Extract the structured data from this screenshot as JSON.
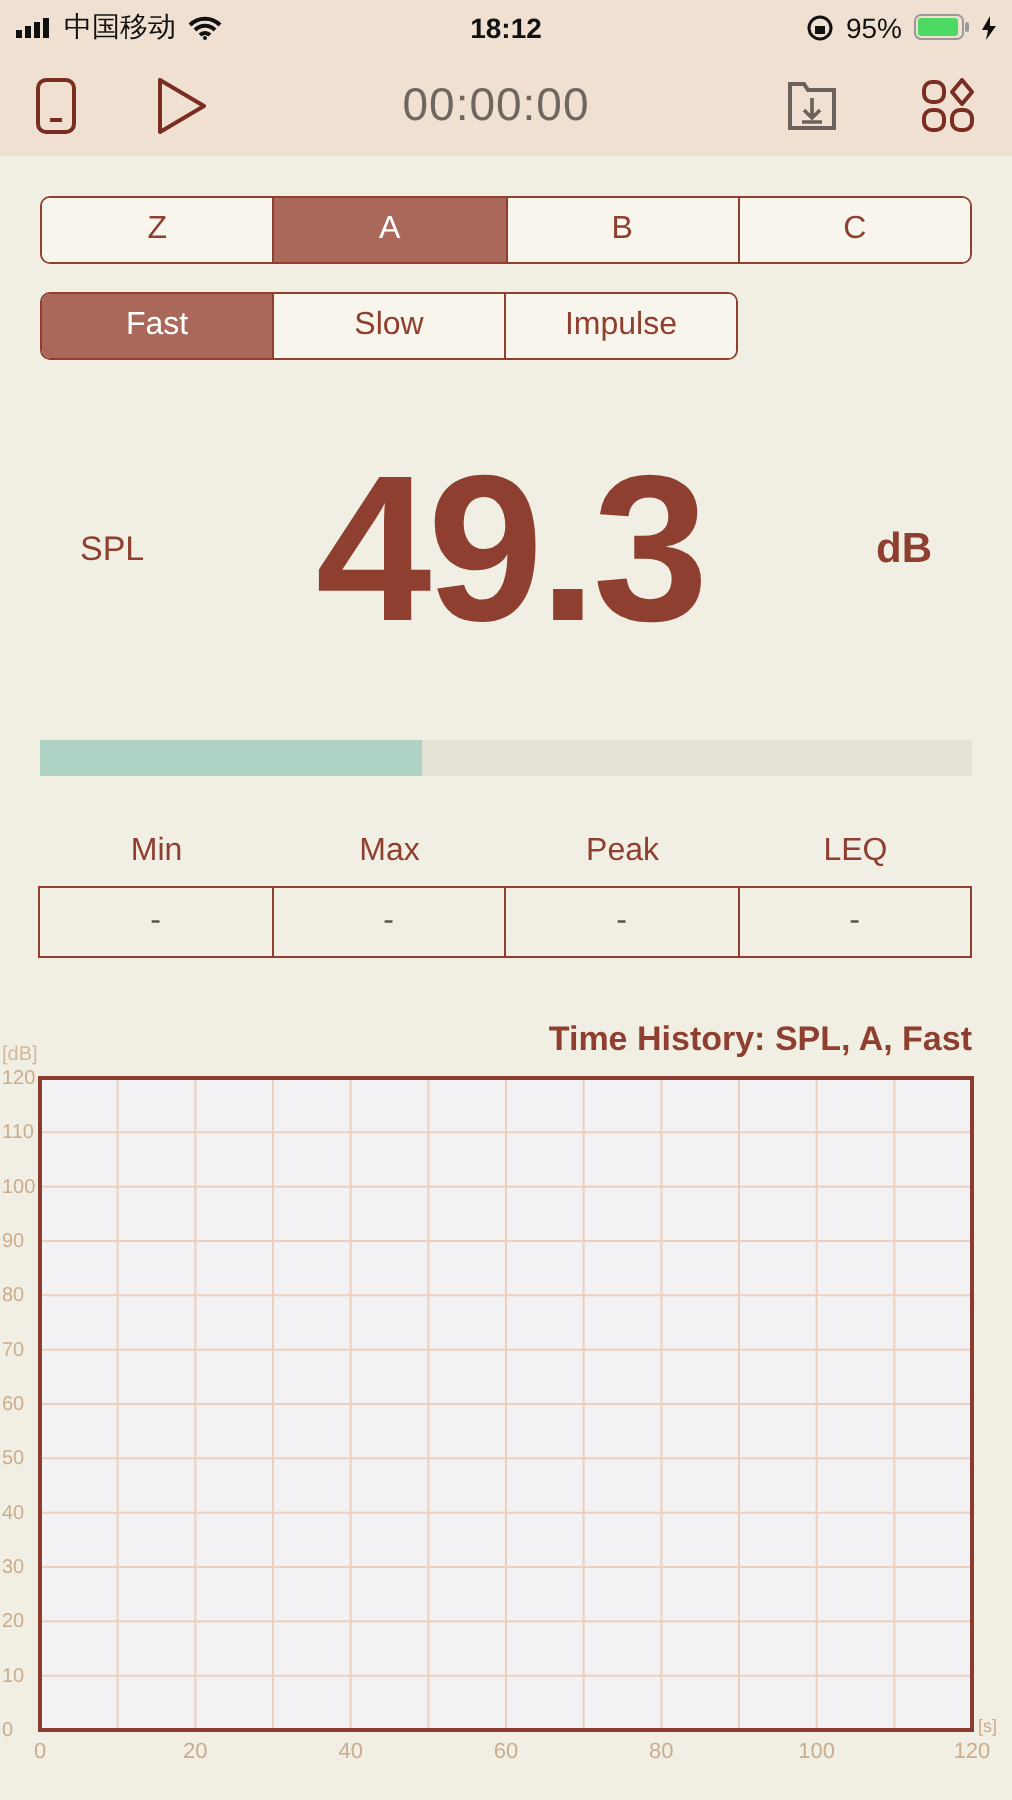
{
  "status_bar": {
    "carrier": "中国移动",
    "time": "18:12",
    "battery": "95%"
  },
  "toolbar": {
    "timer": "00:00:00"
  },
  "weightings": [
    {
      "label": "Z",
      "selected": false
    },
    {
      "label": "A",
      "selected": true
    },
    {
      "label": "B",
      "selected": false
    },
    {
      "label": "C",
      "selected": false
    }
  ],
  "responses": [
    {
      "label": "Fast",
      "selected": true
    },
    {
      "label": "Slow",
      "selected": false
    },
    {
      "label": "Impulse",
      "selected": false
    }
  ],
  "reading": {
    "label": "SPL",
    "value": "49.3",
    "unit": "dB",
    "level": 0.41
  },
  "stats": [
    {
      "label": "Min",
      "value": "-"
    },
    {
      "label": "Max",
      "value": "-"
    },
    {
      "label": "Peak",
      "value": "-"
    },
    {
      "label": "LEQ",
      "value": "-"
    }
  ],
  "chart": {
    "chart_data": {
      "type": "line",
      "title": "Time History: SPL, A, Fast",
      "xlabel": "[s]",
      "ylabel": "[dB]",
      "xlim": [
        0,
        120
      ],
      "ylim": [
        0,
        120
      ],
      "grid": true,
      "xticks": [
        0,
        20,
        40,
        60,
        80,
        100,
        120
      ],
      "yticks": [
        0,
        10,
        20,
        30,
        40,
        50,
        60,
        70,
        80,
        90,
        100,
        110,
        120
      ]
    }
  }
}
